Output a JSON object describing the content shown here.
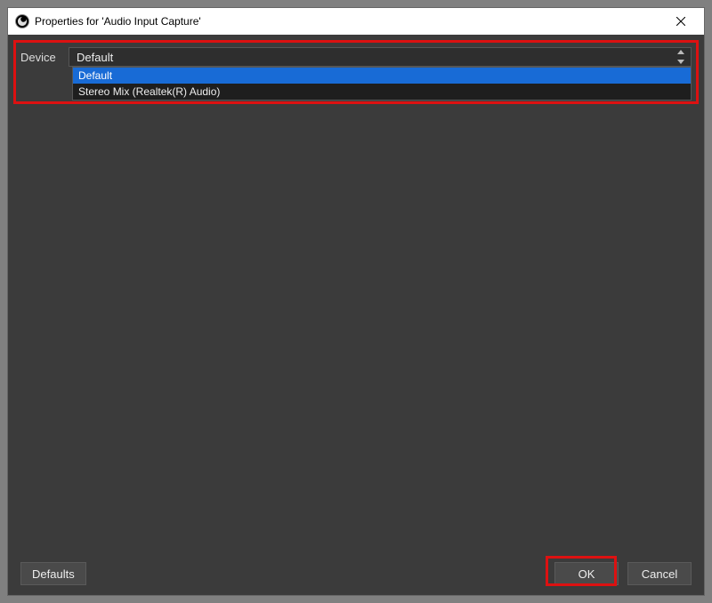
{
  "window": {
    "title": "Properties for 'Audio Input Capture'"
  },
  "device": {
    "label": "Device",
    "selected": "Default",
    "options": [
      "Default",
      "Stereo Mix (Realtek(R) Audio)"
    ]
  },
  "footer": {
    "defaults_label": "Defaults",
    "ok_label": "OK",
    "cancel_label": "Cancel"
  }
}
